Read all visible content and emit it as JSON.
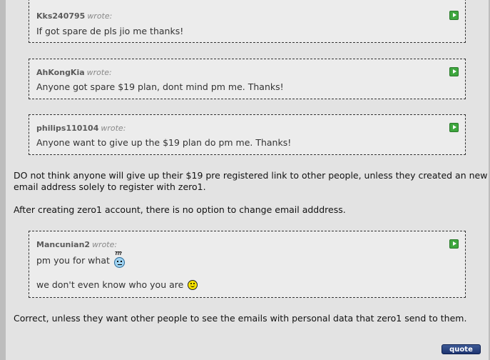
{
  "quotes": [
    {
      "author": "Kks240795",
      "wrote": "wrote:",
      "text": "If got spare de pls jio me thanks!"
    },
    {
      "author": "AhKongKia",
      "wrote": "wrote:",
      "text": "Anyone got spare $19 plan, dont mind pm me. Thanks!"
    },
    {
      "author": "philips110104",
      "wrote": "wrote:",
      "text": "Anyone want to give up the $19 plan do pm me. Thanks!"
    }
  ],
  "reply": {
    "para1_line1": "DO not think anyone will give up their $19 pre registered link to other people, unless they created an new",
    "para1_line2": "email address solely to register with zero1.",
    "para2": "After creating zero1 account, there is no option to change email adddress."
  },
  "quote4": {
    "author": "Mancunian2",
    "wrote": "wrote:",
    "line1": "pm you for what",
    "line2": "we don't even know who you are",
    "confused_marks": "???"
  },
  "closing": "Correct, unless they want other people to see the emails with personal data that zero1 send to them.",
  "quote_button": "quote",
  "icons": {
    "view_post": "view-post-icon",
    "confused": "confused-smiley-icon",
    "smile": "smile-smiley-icon"
  }
}
